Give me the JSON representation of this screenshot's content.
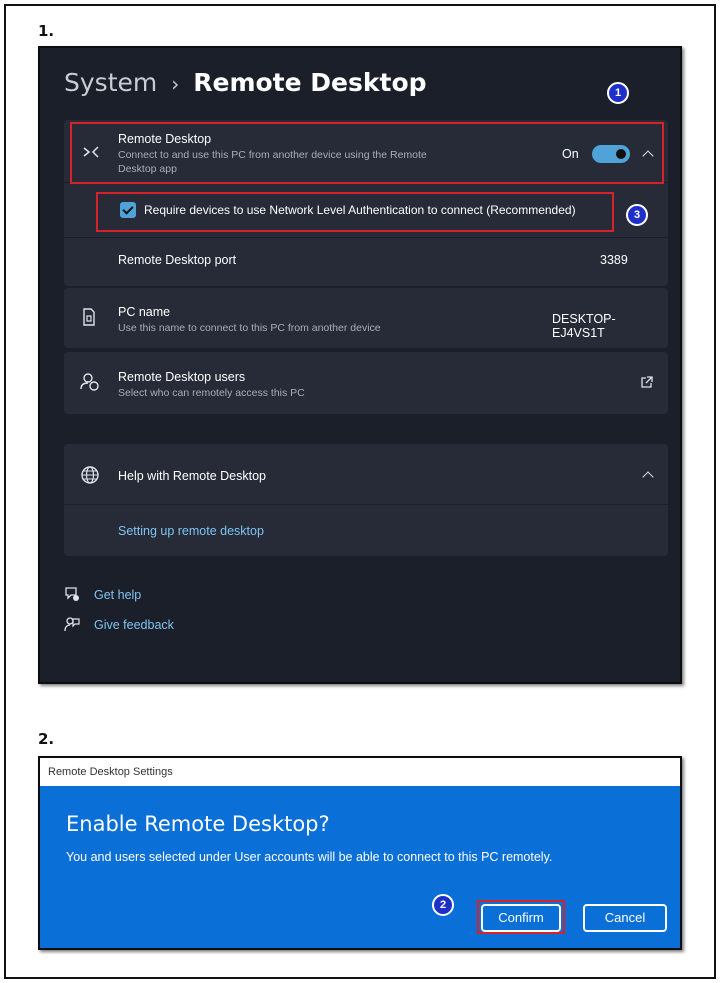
{
  "labels": {
    "step1": "1.",
    "step2": "2."
  },
  "settings": {
    "breadcrumb": {
      "parent": "System",
      "separator": "›",
      "current": "Remote Desktop"
    },
    "remote_desktop": {
      "title": "Remote Desktop",
      "subtitle_line1": "Connect to and use this PC from another device using the Remote",
      "subtitle_line2": "Desktop app",
      "state_label": "On",
      "toggle_on": true
    },
    "nla": {
      "label": "Require devices to use Network Level Authentication to connect (Recommended)",
      "checked": true
    },
    "port": {
      "label": "Remote Desktop port",
      "value": "3389"
    },
    "pc_name": {
      "title": "PC name",
      "subtitle": "Use this name to connect to this PC from another device",
      "value": "DESKTOP-EJ4VS1T"
    },
    "users": {
      "title": "Remote Desktop users",
      "subtitle": "Select who can remotely access this PC"
    },
    "help": {
      "title": "Help with Remote Desktop",
      "link": "Setting up remote desktop"
    },
    "footer": {
      "get_help": "Get help",
      "give_feedback": "Give feedback"
    },
    "badges": {
      "one": "1",
      "three": "3"
    }
  },
  "dialog": {
    "window_title": "Remote Desktop Settings",
    "heading": "Enable Remote Desktop?",
    "body": "You and users selected under User accounts will be able to connect to this PC remotely.",
    "confirm_label": "Confirm",
    "cancel_label": "Cancel",
    "badge_two": "2"
  },
  "colors": {
    "settings_bg": "#1b1f2a",
    "panel_bg": "#262b37",
    "accent": "#4fa3d8",
    "highlight_red": "#d6232a",
    "badge_blue": "#1f30c8",
    "dialog_blue": "#0a6fd6"
  },
  "icons": [
    "remote-desktop-icon",
    "pc-name-icon",
    "users-icon",
    "globe-icon",
    "get-help-icon",
    "feedback-icon",
    "external-link-icon",
    "chevron-up-icon"
  ]
}
